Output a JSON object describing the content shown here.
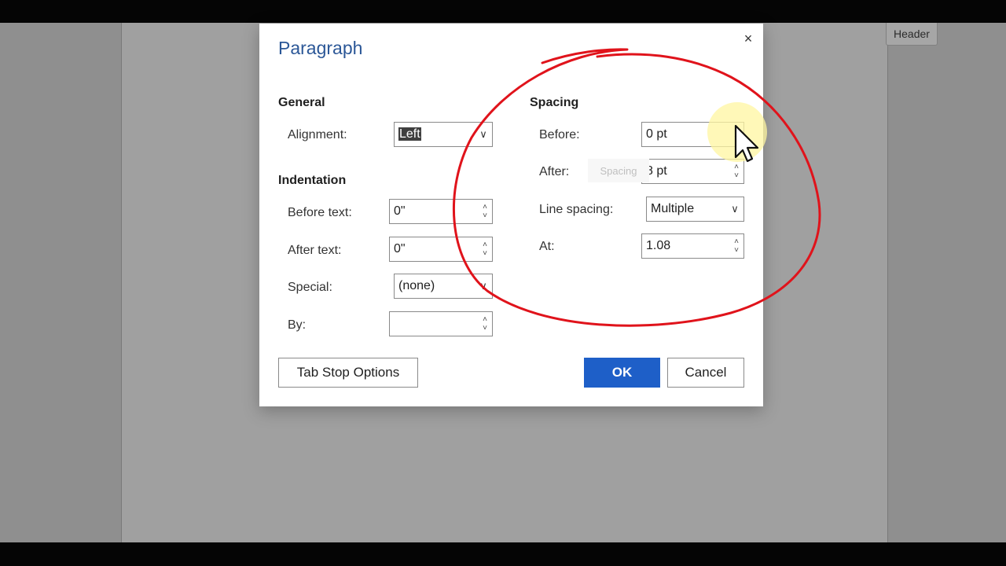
{
  "background": {
    "header_tag": "Header"
  },
  "dialog": {
    "title": "Paragraph",
    "close_icon": "×",
    "general": {
      "title": "General",
      "alignment_label": "Alignment:",
      "alignment_value": "Left"
    },
    "indentation": {
      "title": "Indentation",
      "before_text_label": "Before text:",
      "before_text_value": "0\"",
      "after_text_label": "After text:",
      "after_text_value": "0\"",
      "special_label": "Special:",
      "special_value": "(none)",
      "by_label": "By:",
      "by_value": ""
    },
    "spacing": {
      "title": "Spacing",
      "before_label": "Before:",
      "before_value": "0 pt",
      "after_label": "After:",
      "after_value": "8 pt",
      "line_spacing_label": "Line spacing:",
      "line_spacing_value": "Multiple",
      "at_label": "At:",
      "at_value": "1.08",
      "tooltip": "Spacing"
    },
    "buttons": {
      "tab_stop_options": "Tab Stop Options",
      "ok": "OK",
      "cancel": "Cancel"
    }
  },
  "colors": {
    "title": "#2b5797",
    "primary": "#1e5fc8",
    "annotation": "#e0131b",
    "cursor_highlight": "#fff5a0"
  },
  "icons": {
    "spin_up": "˄",
    "spin_down": "˅",
    "dropdown": "∨"
  }
}
